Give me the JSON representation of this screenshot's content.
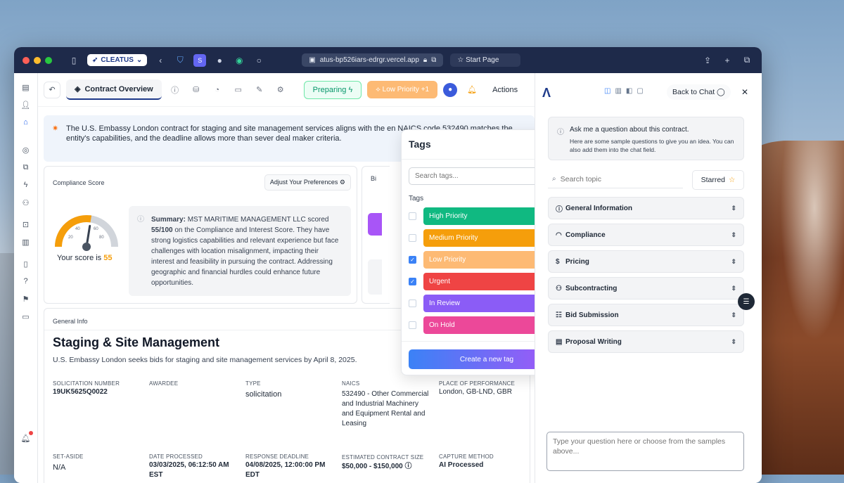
{
  "browser": {
    "app_button": "CLEATUS",
    "url": "atus-bp526iars-edrgr.vercel.app",
    "start_page": "Start Page"
  },
  "toolbar": {
    "active_tab": "Contract Overview",
    "preparing": "Preparing",
    "low_priority": "Low Priority",
    "low_priority_count": "+1",
    "actions": "Actions"
  },
  "banner": {
    "text": "The U.S. Embassy London contract for staging and site management services aligns with the en NAICS code 532490 matches the entity's capabilities, and the deadline allows more than sever deal maker criteria."
  },
  "compliance": {
    "title": "Compliance Score",
    "adjust": "Adjust Your Preferences",
    "score": "55",
    "score_label": "Your score is",
    "gauge_ticks": [
      "20",
      "40",
      "60",
      "80"
    ],
    "gauge_value": 55,
    "summary_label": "Summary:",
    "summary_text": "MST MARITIME MANAGEMENT LLC scored",
    "summary_score": "55/100",
    "summary_rest": "on the Compliance and Interest Score. They have strong logistics capabilities and relevant experience but face challenges with location misalignment, impacting their interest and feasibility in pursuing the contract. Addressing geographic and financial hurdles could enhance future opportunities."
  },
  "side_card_label": "Bi",
  "general": {
    "label": "General Info",
    "title": "Staging & Site Management",
    "subtitle": "U.S. Embassy London seeks bids for staging and site management services by April 8, 2025.",
    "fields": [
      {
        "label": "SOLICITATION NUMBER",
        "value": "19UK5625Q0022"
      },
      {
        "label": "AWARDEE",
        "value": ""
      },
      {
        "label": "TYPE",
        "value": "solicitation"
      },
      {
        "label": "NAICS",
        "value": "532490 - Other Commercial and Industrial Machinery and Equipment Rental and Leasing"
      },
      {
        "label": "PLACE OF PERFORMANCE",
        "value": "London, GB-LND, GBR"
      },
      {
        "label": "SET-ASIDE",
        "value": "N/A"
      },
      {
        "label": "DATE PROCESSED",
        "value": "03/03/2025, 06:12:50 AM EST"
      },
      {
        "label": "RESPONSE DEADLINE",
        "value": "04/08/2025, 12:00:00 PM EDT"
      },
      {
        "label": "ESTIMATED CONTRACT SIZE",
        "value": "$50,000 - $150,000"
      },
      {
        "label": "CAPTURE METHOD",
        "value": "AI Processed"
      }
    ]
  },
  "tags": {
    "title": "Tags",
    "search_placeholder": "Search tags...",
    "section": "Tags",
    "create": "Create a new tag",
    "items": [
      {
        "label": "High Priority",
        "color": "#10b981",
        "checked": false
      },
      {
        "label": "Medium Priority",
        "color": "#f59e0b",
        "checked": false
      },
      {
        "label": "Low Priority",
        "color": "#fdba74",
        "checked": true
      },
      {
        "label": "Urgent",
        "color": "#ef4444",
        "checked": true
      },
      {
        "label": "In Review",
        "color": "#8b5cf6",
        "checked": false
      },
      {
        "label": "On Hold",
        "color": "#ec4899",
        "checked": false
      }
    ]
  },
  "chat": {
    "back": "Back to Chat",
    "ask_title": "Ask me a question about this contract.",
    "ask_sub": "Here are some sample questions to give you an idea. You can also add them into the chat field.",
    "search_placeholder": "Search topic",
    "starred": "Starred",
    "topics": [
      "General Information",
      "Compliance",
      "Pricing",
      "Subcontracting",
      "Bid Submission",
      "Proposal Writing"
    ],
    "input_placeholder": "Type your question here or choose from the samples above..."
  }
}
